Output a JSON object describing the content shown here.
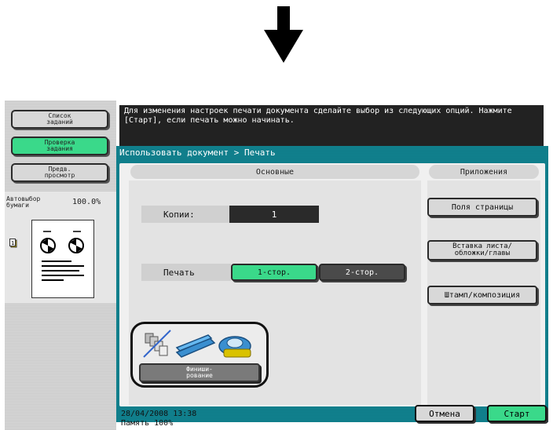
{
  "colors": {
    "accent_green": "#3ad98a",
    "teal": "#0f7a88",
    "message_bg": "#222222"
  },
  "left_panel": {
    "job_list_label": "Список\nзаданий",
    "check_job_label": "Проверка\nзадания",
    "preview_label": "Предв.\nпросмотр",
    "paper_auto_label": "Автовыбор\nбумаги",
    "zoom": "100.0%"
  },
  "message": "Для изменения настроек печати документа сделайте выбор из следующих опций. Нажмите [Старт], если печать можно начинать.",
  "breadcrumb": "Использовать документ > Печать",
  "sections": {
    "basic": "Основные",
    "applications": "Приложения"
  },
  "copies": {
    "label": "Копии:",
    "value": "1"
  },
  "print": {
    "label": "Печать",
    "option1": "1-стор.",
    "option2": "2-стор."
  },
  "finishing": {
    "label": "Финиши-\nрование",
    "icons": [
      "sort-icon",
      "stapler-icon",
      "hole-punch-icon"
    ]
  },
  "applications": {
    "page_margin": "Поля страницы",
    "insert_sheet": "Вставка листа/\nобложки/главы",
    "stamp": "Штамп/композиция"
  },
  "status": {
    "datetime": "28/04/2008   13:38",
    "memory": "Память        100%"
  },
  "actions": {
    "cancel": "Отмена",
    "start": "Старт"
  }
}
